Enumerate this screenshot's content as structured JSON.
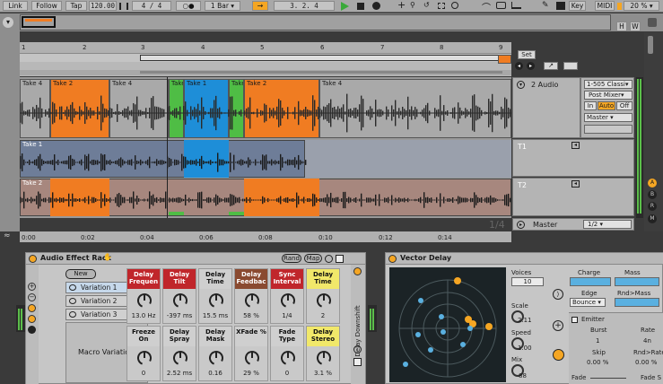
{
  "control_bar": {
    "link": "Link",
    "follow": "Follow",
    "tap": "Tap",
    "tempo": "120.00",
    "signature": "4 / 4",
    "quantize": "1 Bar",
    "position": "3.   2.   4",
    "key": "Key",
    "midi": "MIDI",
    "cpu": "20 %",
    "h_btn": "H",
    "w_btn": "W"
  },
  "ruler": {
    "marks": [
      "1",
      "2",
      "3",
      "4",
      "5",
      "6",
      "7",
      "8",
      "9"
    ]
  },
  "set": {
    "label": "Set"
  },
  "arrangement": {
    "audio_lane_takes": [
      {
        "name": "Take 4",
        "color": "#a9a9a9"
      },
      {
        "name": "Take 2",
        "color": "#f07c22"
      },
      {
        "name": "Take 4",
        "color": "#a9a9a9"
      },
      {
        "name": "Take 3",
        "color": "#4fbd45"
      },
      {
        "name": "Take 1",
        "color": "#1e8ed8"
      },
      {
        "name": "Take 3",
        "color": "#4fbd45"
      },
      {
        "name": "Take 2",
        "color": "#f07c22"
      },
      {
        "name": "Take 4",
        "color": "#a9a9a9"
      }
    ],
    "take_lanes": [
      {
        "name": "Take 1",
        "lane": "T1"
      },
      {
        "name": "Take 2",
        "lane": "T2"
      }
    ],
    "fraction": "1/4",
    "time_ticks": [
      "0:00",
      "0:02",
      "0:04",
      "0:06",
      "0:08",
      "0:10",
      "0:12",
      "0:14"
    ]
  },
  "track": {
    "name": "2 Audio",
    "input": "1-505 Classi",
    "monitor": "Post Mixer",
    "in": "In",
    "auto": "Auto",
    "off": "Off",
    "output": "Master",
    "master_label": "Master",
    "master_value": "1/2"
  },
  "rack": {
    "title": "Audio Effect Rack",
    "rand": "Rand",
    "map": "Map",
    "new": "New",
    "variations": [
      "Variation 1",
      "Variation 2",
      "Variation 3"
    ],
    "macro_variations": "Macro Variations",
    "side_label": "Delay Downshift",
    "macros": [
      {
        "name": "Delay Frequen",
        "value": "13.0 Hz",
        "color": "#c0262b",
        "text": "#ffffff"
      },
      {
        "name": "Delay Tilt",
        "value": "-397 ms",
        "color": "#c0262b",
        "text": "#ffffff"
      },
      {
        "name": "Delay Time",
        "value": "15.5 ms",
        "color": "#cfcfcf",
        "text": "#111111"
      },
      {
        "name": "Delay Feedbac",
        "value": "58 %",
        "color": "#8a4a30",
        "text": "#ffffff"
      },
      {
        "name": "Sync Interval",
        "value": "1/4",
        "color": "#c0262b",
        "text": "#ffffff"
      },
      {
        "name": "Delay Time",
        "value": "2",
        "color": "#f1e86a",
        "text": "#111111"
      },
      {
        "name": "Freeze On",
        "value": "0",
        "color": "#cfcfcf",
        "text": "#111111"
      },
      {
        "name": "Delay Spray",
        "value": "2.52 ms",
        "color": "#cfcfcf",
        "text": "#111111"
      },
      {
        "name": "Delay Mask",
        "value": "0.16",
        "color": "#cfcfcf",
        "text": "#111111"
      },
      {
        "name": "XFade %",
        "value": "29 %",
        "color": "#cfcfcf",
        "text": "#111111"
      },
      {
        "name": "Fade Type",
        "value": "0",
        "color": "#cfcfcf",
        "text": "#111111"
      },
      {
        "name": "Delay Stereo",
        "value": "3.1 %",
        "color": "#f1e86a",
        "text": "#111111"
      }
    ]
  },
  "vector": {
    "title": "Vector Delay",
    "voices_label": "Voices",
    "voices_value": "10",
    "scale_label": "Scale",
    "scale_value": "2.11",
    "speed_label": "Speed",
    "speed_value": "1.00",
    "mix_label": "Mix",
    "mix_value": "88",
    "charge": "Charge",
    "mass": "Mass",
    "edge": "Edge",
    "edge_value": "Bounce",
    "rnd_mass": "Rnd>Mass",
    "emitter": "Emitter",
    "burst": "Burst",
    "burst_value": "1",
    "rate": "Rate",
    "rate_value": "4n",
    "skip": "Skip",
    "skip_value": "0.00 %",
    "rnd_rate": "Rnd>Rate",
    "rnd_rate_value": "0.00 %",
    "fade": "Fade",
    "fade_s": "Fade S"
  }
}
